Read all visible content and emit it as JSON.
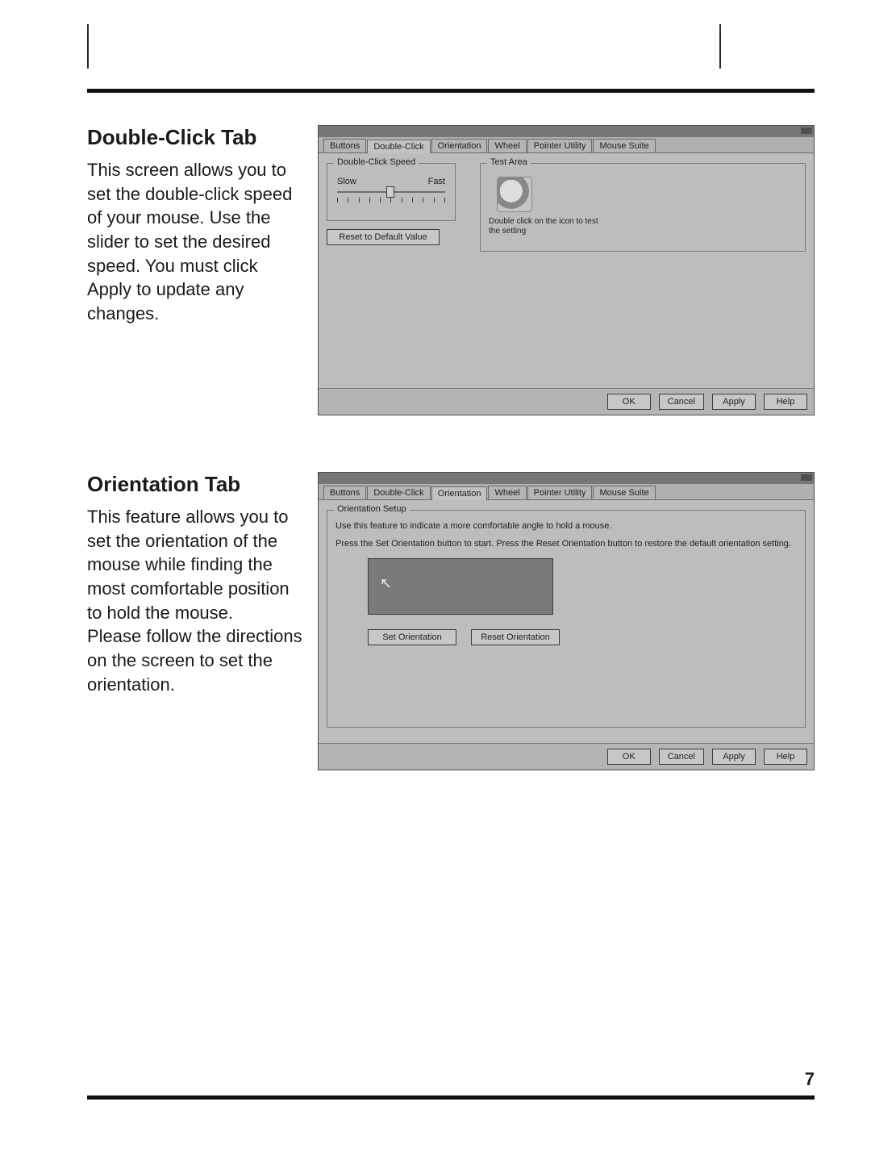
{
  "page": {
    "number": "7"
  },
  "section1": {
    "heading": "Double-Click Tab",
    "body": "This screen allows you to set the double-click speed of your mouse.  Use the slider to set the desired speed.  You must click Apply to update any changes."
  },
  "section2": {
    "heading": "Orientation Tab",
    "body": "This feature allows you to set the orientation of the mouse while finding the most comfortable position to hold the mouse.\nPlease follow the directions on the screen to set the orientation."
  },
  "dialog_tabs": {
    "buttons": "Buttons",
    "double_click": "Double-Click",
    "orientation": "Orientation",
    "wheel": "Wheel",
    "pointer_utility": "Pointer Utility",
    "mouse_suite": "Mouse Suite"
  },
  "dlg1": {
    "group_speed_title": "Double-Click Speed",
    "slow": "Slow",
    "fast": "Fast",
    "reset_btn": "Reset to Default Value",
    "group_test_title": "Test Area",
    "test_caption": "Double click on the icon to test the setting"
  },
  "dlg2": {
    "group_title": "Orientation Setup",
    "line1": "Use this feature to indicate a more comfortable angle to hold a mouse.",
    "line2": "Press the Set Orientation button to start. Press the Reset Orientation button to restore the default orientation setting.",
    "set_btn": "Set Orientation",
    "reset_btn": "Reset Orientation"
  },
  "footer_btns": {
    "ok": "OK",
    "cancel": "Cancel",
    "apply": "Apply",
    "help": "Help"
  }
}
